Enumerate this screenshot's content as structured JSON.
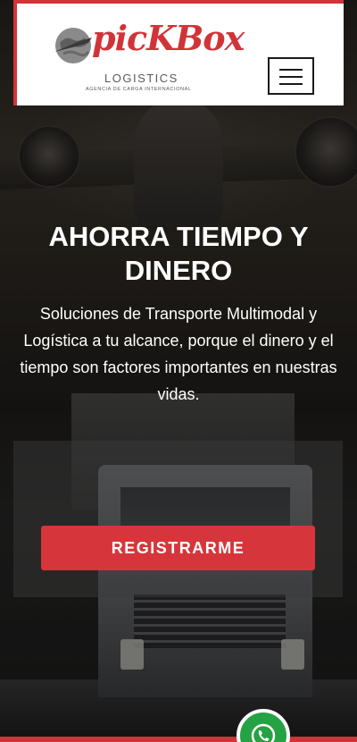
{
  "header": {
    "logo_wordmark": "picKBox",
    "logo_subtitle": "LOGISTICS",
    "logo_tagline": "AGENCIA DE CARGA INTERNACIONAL",
    "menu_icon": "hamburger-icon"
  },
  "hero": {
    "headline": "AHORRA TIEMPO Y DINERO",
    "description": "Soluciones de Transporte Multimodal y Logística a tu alcance, porque el dinero y el tiempo son factores importantes en nuestras vidas.",
    "cta_label": "REGISTRARME"
  },
  "floating": {
    "whatsapp_icon": "whatsapp-icon"
  },
  "colors": {
    "brand_red": "#d13438",
    "button_red": "#d6363b",
    "whatsapp_green": "#25a244"
  }
}
